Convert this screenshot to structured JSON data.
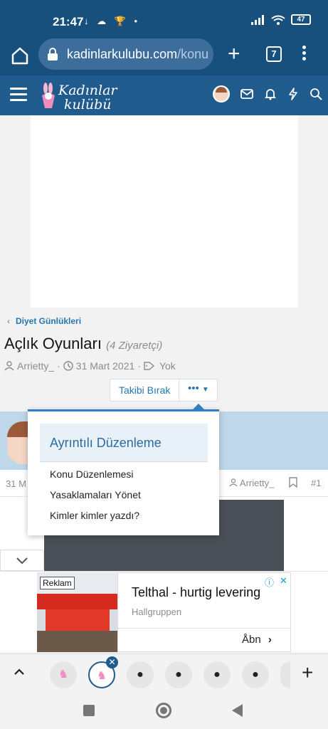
{
  "status_bar": {
    "time": "21:47",
    "notif_icons": "↓ ☁ 🏆 •",
    "battery": "47"
  },
  "browser": {
    "url_host": "kadinlarkulubu.com",
    "url_path": "/konu",
    "tab_count": "7"
  },
  "site": {
    "logo_line1": "Kadınlar",
    "logo_line2": "kulübü"
  },
  "thread": {
    "breadcrumb": "Diyet Günlükleri",
    "title": "Açlık Oyunları",
    "visitors": "(4 Ziyaretçi)",
    "author": "Arrietty_",
    "date": "31 Mart 2021",
    "tags": "Yok",
    "unfollow_label": "Takibi Bırak",
    "more_label": "•••"
  },
  "dropdown": {
    "header": "Ayrıntılı Düzenleme",
    "items": [
      "Konu Düzenlemesi",
      "Yasaklamaları Yönet",
      "Kimler kimler yazdı?"
    ]
  },
  "post": {
    "date_partial": "31 M",
    "author": "Arrietty_",
    "number": "#1"
  },
  "ad": {
    "label": "Reklam",
    "title": "Telthal - hurtig levering",
    "advertiser": "Hallgruppen",
    "cta": "Åbn"
  },
  "colors": {
    "header_bg": "#174f7d",
    "site_header_bg": "#1f5b8c",
    "link": "#2577b1",
    "accent": "#2f7fc1"
  }
}
